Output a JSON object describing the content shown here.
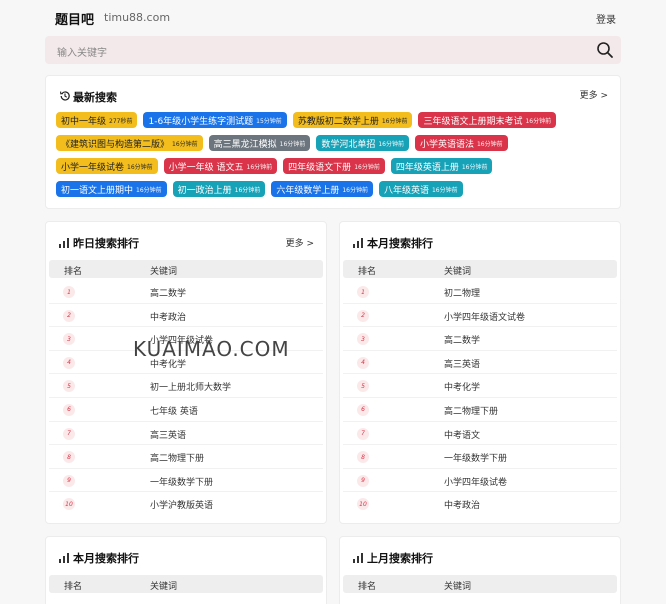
{
  "header": {
    "brand": "题目吧",
    "domain": "timu88.com",
    "login": "登录"
  },
  "search": {
    "placeholder": "输入关键字"
  },
  "latest": {
    "title": "最新搜索",
    "more": "更多 >",
    "rows": [
      [
        {
          "text": "初中一年级",
          "time": "277秒前",
          "color": "yellow"
        },
        {
          "text": "1-6年级小学生练字测试题",
          "time": "15分钟前",
          "color": "blue"
        },
        {
          "text": "苏教版初二数学上册",
          "time": "16分钟前",
          "color": "yellow"
        },
        {
          "text": "三年级语文上册期末考试",
          "time": "16分钟前",
          "color": "red"
        }
      ],
      [
        {
          "text": "《建筑识图与构造第二版》",
          "time": "16分钟前",
          "color": "yellow"
        },
        {
          "text": "高三黑龙江模拟",
          "time": "16分钟前",
          "color": "gray"
        },
        {
          "text": "数学河北单招",
          "time": "16分钟前",
          "color": "teal"
        },
        {
          "text": "小学英语语法",
          "time": "16分钟前",
          "color": "red"
        }
      ],
      [
        {
          "text": "小学一年级试卷",
          "time": "16分钟前",
          "color": "yellow"
        },
        {
          "text": "小学一年级 语文五",
          "time": "16分钟前",
          "color": "red"
        },
        {
          "text": "四年级语文下册",
          "time": "16分钟前",
          "color": "red"
        },
        {
          "text": "四年级英语上册",
          "time": "16分钟前",
          "color": "teal"
        }
      ],
      [
        {
          "text": "初一语文上册期中",
          "time": "16分钟前",
          "color": "blue"
        },
        {
          "text": "初一政治上册",
          "time": "16分钟前",
          "color": "teal"
        },
        {
          "text": "六年级数学上册",
          "time": "16分钟前",
          "color": "blue"
        },
        {
          "text": "八年级英语",
          "time": "16分钟前",
          "color": "teal"
        }
      ]
    ]
  },
  "yesterday": {
    "title": "昨日搜索排行",
    "more": "更多 >",
    "col_rank": "排名",
    "col_kw": "关键词",
    "items": [
      "高二数学",
      "中考政治",
      "小学四年级试卷",
      "中考化学",
      "初一上册北师大数学",
      "七年级 英语",
      "高三英语",
      "高二物理下册",
      "一年级数学下册",
      "小学沪教版英语"
    ]
  },
  "month": {
    "title": "本月搜索排行",
    "col_rank": "排名",
    "col_kw": "关键词",
    "items": [
      "初二物理",
      "小学四年级语文试卷",
      "高二数学",
      "高三英语",
      "中考化学",
      "高二物理下册",
      "中考语文",
      "一年级数学下册",
      "小学四年级试卷",
      "中考政治"
    ]
  },
  "month2": {
    "title": "本月搜索排行",
    "col_rank": "排名",
    "col_kw": "关键词"
  },
  "lastmonth": {
    "title": "上月搜索排行",
    "col_rank": "排名",
    "col_kw": "关键词"
  },
  "watermark": {
    "text": "KUAIMAO.COM"
  },
  "colors": {
    "yellow": "#f2bd1d",
    "blue": "#1a73e8",
    "red": "#d93449",
    "gray": "#6c757d",
    "teal": "#17a2b8"
  }
}
